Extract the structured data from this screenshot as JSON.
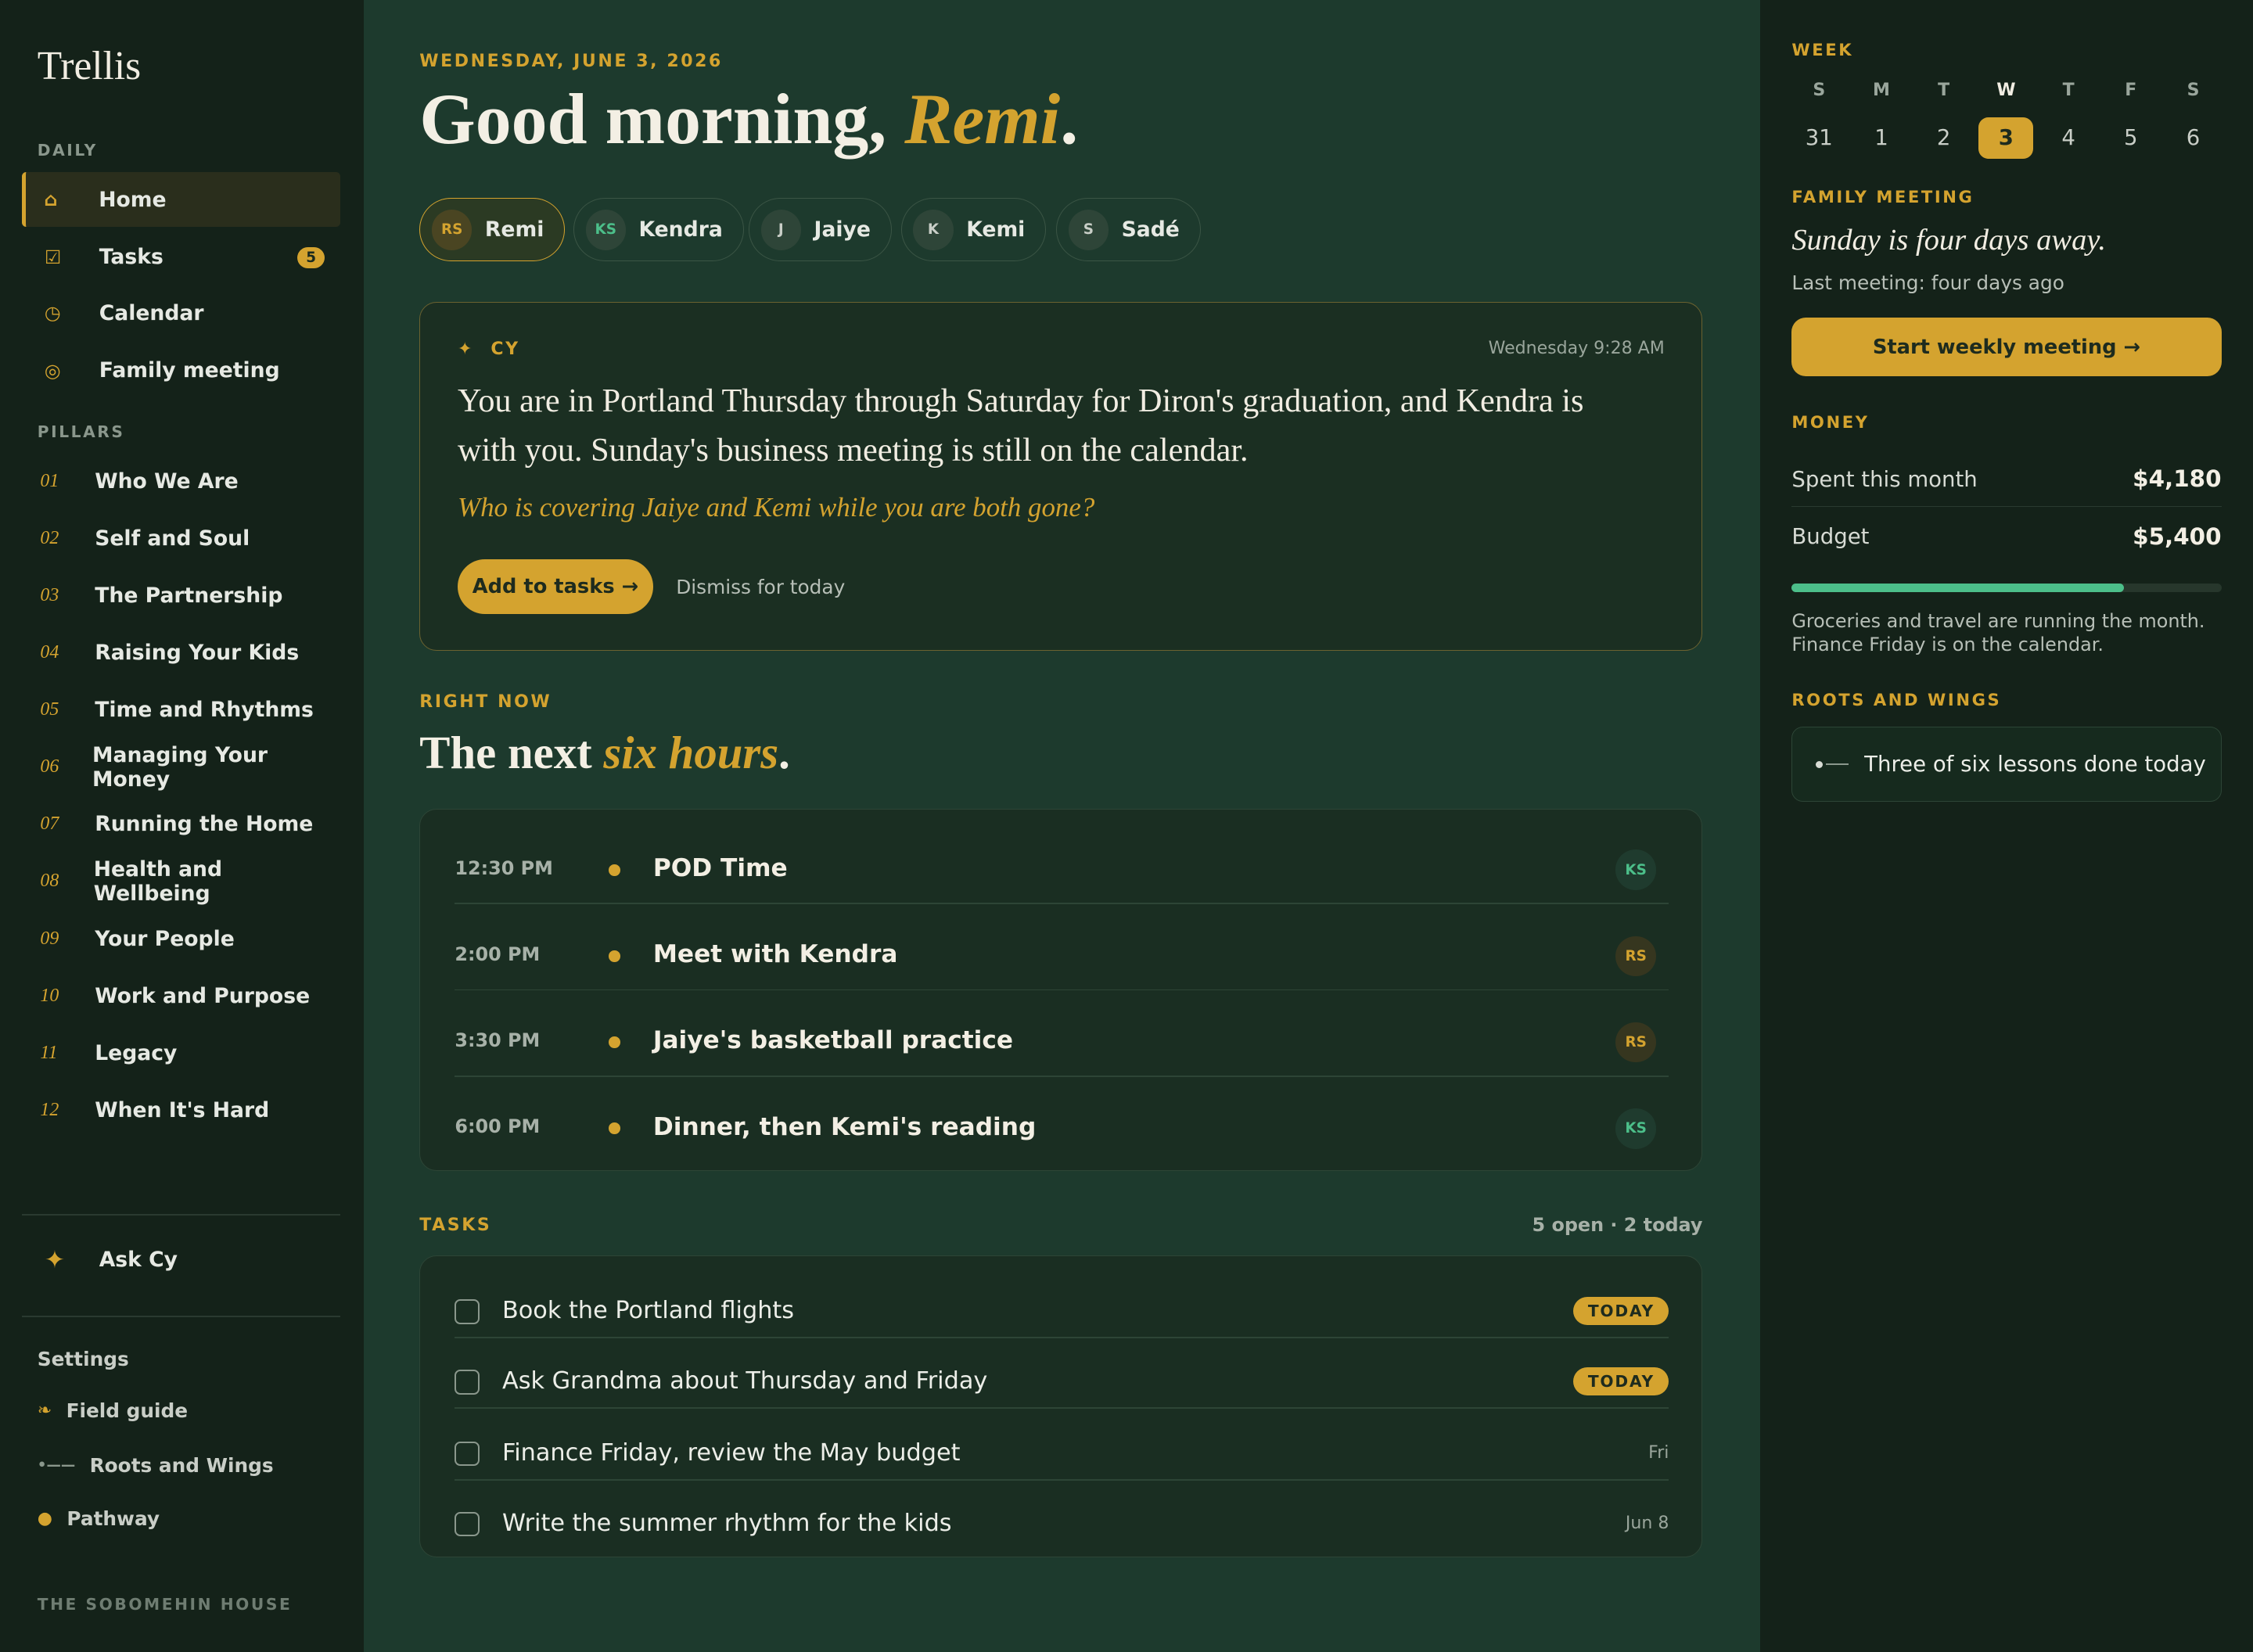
{
  "sidebar": {
    "brand": "Trellis",
    "daily_label": "DAILY",
    "daily": [
      {
        "label": "Home",
        "icon": "home-icon",
        "glyph": "⌂"
      },
      {
        "label": "Tasks",
        "icon": "checkbox-icon",
        "glyph": "☑",
        "badge": "5"
      },
      {
        "label": "Calendar",
        "icon": "clock-icon",
        "glyph": "◷"
      },
      {
        "label": "Family meeting",
        "icon": "circle-target-icon",
        "glyph": "◎"
      }
    ],
    "pillars_label": "PILLARS",
    "pillars": [
      {
        "num": "01",
        "label": "Who We Are"
      },
      {
        "num": "02",
        "label": "Self and Soul"
      },
      {
        "num": "03",
        "label": "The Partnership"
      },
      {
        "num": "04",
        "label": "Raising Your Kids"
      },
      {
        "num": "05",
        "label": "Time and Rhythms"
      },
      {
        "num": "06",
        "label": "Managing Your Money"
      },
      {
        "num": "07",
        "label": "Running the Home"
      },
      {
        "num": "08",
        "label": "Health and Wellbeing"
      },
      {
        "num": "09",
        "label": "Your People"
      },
      {
        "num": "10",
        "label": "Work and Purpose"
      },
      {
        "num": "11",
        "label": "Legacy"
      },
      {
        "num": "12",
        "label": "When It's Hard"
      }
    ],
    "ask_cy": "Ask Cy",
    "settings": "Settings",
    "field_guide": "Field guide",
    "roots_wings": "Roots and Wings",
    "pathway": "Pathway",
    "house": "THE SOBOMEHIN HOUSE"
  },
  "main": {
    "date": "WEDNESDAY, JUNE 3, 2026",
    "greeting": "Good morning,",
    "greeting_name": "Remi",
    "greeting_end": ".",
    "people": [
      {
        "initials": "RS",
        "name": "Remi"
      },
      {
        "initials": "KS",
        "name": "Kendra"
      },
      {
        "initials": "J",
        "name": "Jaiye"
      },
      {
        "initials": "K",
        "name": "Kemi"
      },
      {
        "initials": "S",
        "name": "Sadé"
      }
    ],
    "cy": {
      "label": "CY",
      "time": "Wednesday 9:28 AM",
      "body": "You are in Portland Thursday through Saturday for Diron's graduation, and Kendra is with you. Sunday's business meeting is still on the calendar.",
      "question": "Who is covering Jaiye and Kemi while you are both gone?",
      "add": "Add to tasks →",
      "dismiss": "Dismiss for today"
    },
    "right_now_label": "RIGHT NOW",
    "right_now_title": "The next",
    "right_now_em": "six hours",
    "right_now_end": ".",
    "schedule": [
      {
        "time": "12:30 PM",
        "title": "POD Time",
        "who": "KS"
      },
      {
        "time": "2:00 PM",
        "title": "Meet with Kendra",
        "who": "RS"
      },
      {
        "time": "3:30 PM",
        "title": "Jaiye's basketball practice",
        "who": "RS"
      },
      {
        "time": "6:00 PM",
        "title": "Dinner, then Kemi's reading",
        "who": "KS"
      }
    ],
    "tasks_label": "TASKS",
    "tasks_count": "5 open · 2 today",
    "tasks": [
      {
        "text": "Book the Portland flights",
        "due": "TODAY"
      },
      {
        "text": "Ask Grandma about Thursday and Friday",
        "due": "TODAY"
      },
      {
        "text": "Finance Friday, review the May budget",
        "due": "Fri"
      },
      {
        "text": "Write the summer rhythm for the kids",
        "due": "Jun 8"
      }
    ]
  },
  "right": {
    "week_label": "WEEK",
    "week": [
      {
        "d": "S",
        "n": "31"
      },
      {
        "d": "M",
        "n": "1"
      },
      {
        "d": "T",
        "n": "2"
      },
      {
        "d": "W",
        "n": "3"
      },
      {
        "d": "T",
        "n": "4"
      },
      {
        "d": "F",
        "n": "5"
      },
      {
        "d": "S",
        "n": "6"
      }
    ],
    "fm_label": "FAMILY MEETING",
    "fm_title": "Sunday is four days away.",
    "fm_sub": "Last meeting: four days ago",
    "fm_btn": "Start weekly meeting →",
    "money_label": "MONEY",
    "spent_k": "Spent this month",
    "spent_v": "$4,180",
    "budget_k": "Budget",
    "budget_v": "$5,400",
    "spent_fraction": 0.774,
    "money_note": "Groceries and travel are running the month. Finance Friday is on the calendar.",
    "rw_label": "ROOTS AND WINGS",
    "rw_text": "Three of six lessons done today"
  },
  "colors": {
    "accent": "#d4a32f",
    "bg": "#1d3a2d",
    "sidebar": "#142219",
    "green": "#4cbf8a"
  }
}
